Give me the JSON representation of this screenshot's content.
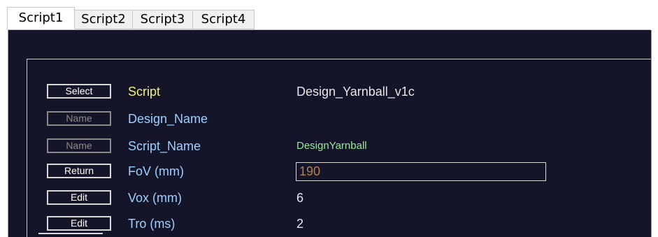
{
  "tabs": [
    {
      "label": "Script1",
      "active": true
    },
    {
      "label": "Script2",
      "active": false
    },
    {
      "label": "Script3",
      "active": false
    },
    {
      "label": "Script4",
      "active": false
    }
  ],
  "rows": [
    {
      "button": "Select",
      "label": "Script",
      "value": "Design_Yarnball_v1c"
    },
    {
      "button": "Name",
      "label": "Design_Name",
      "value": ""
    },
    {
      "button": "Name",
      "label": "Script_Name",
      "value": "DesignYarnball"
    },
    {
      "button": "Return",
      "label": "FoV (mm)",
      "value": "190"
    },
    {
      "button": "Edit",
      "label": "Vox (mm)",
      "value": "6"
    },
    {
      "button": "Edit",
      "label": "Tro (ms)",
      "value": "2"
    }
  ],
  "colors": {
    "panel_background": "#15152a",
    "script_label": "#f2f07a",
    "field_label": "#9ecfff",
    "script_name_value": "#9ae89a",
    "fov_input_text": "#b8804e"
  }
}
